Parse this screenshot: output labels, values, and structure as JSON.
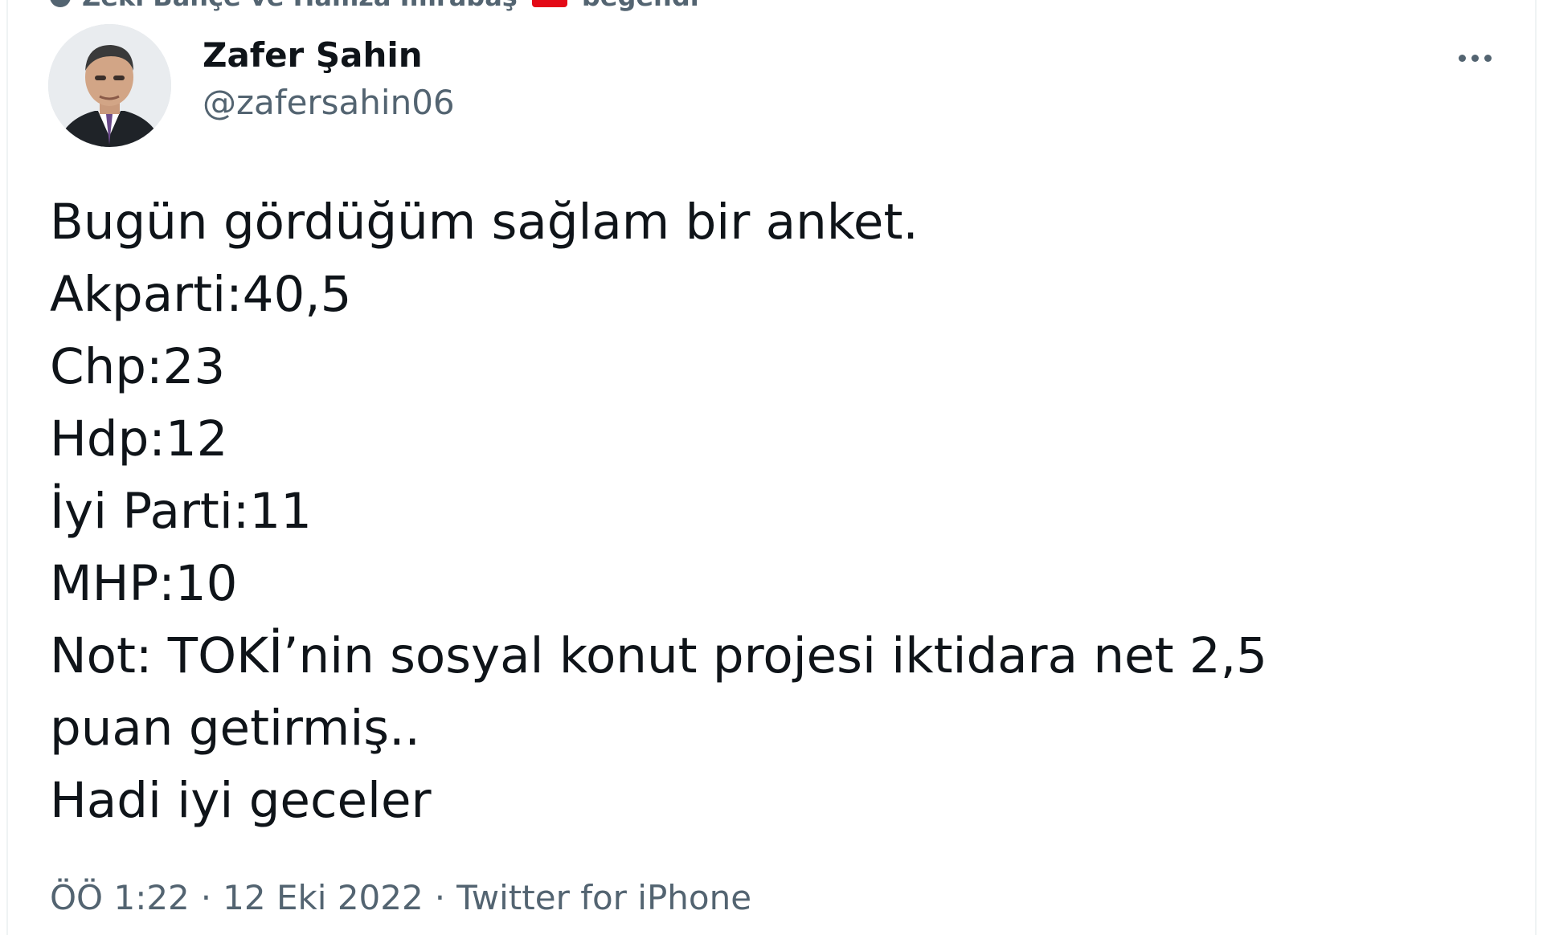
{
  "social_context": {
    "text_before": "Zeki Bahçe ve Hamza Imrabaş",
    "text_after": "beğendi"
  },
  "author": {
    "name": "Zafer Şahin",
    "handle": "@zafersahin06"
  },
  "tweet": {
    "lines": [
      "Bugün gördüğüm sağlam bir anket.",
      "Akparti:40,5",
      "Chp:23",
      "Hdp:12",
      "İyi Parti:11",
      "MHP:10",
      "Not: TOKİ’nin sosyal konut projesi iktidara net 2,5",
      "puan getirmiş..",
      "Hadi iyi geceler"
    ]
  },
  "meta": {
    "time": "ÖÖ 1:22",
    "separator1": "·",
    "date": "12 Eki 2022",
    "separator2": "·",
    "source": "Twitter for iPhone"
  },
  "colors": {
    "text_primary": "#0f1419",
    "text_secondary": "#536471",
    "flag": "#e30a17"
  },
  "icons": {
    "more": "more-horizontal-icon",
    "pin": "liked-by-icon",
    "flag": "turkish-flag-emoji"
  }
}
